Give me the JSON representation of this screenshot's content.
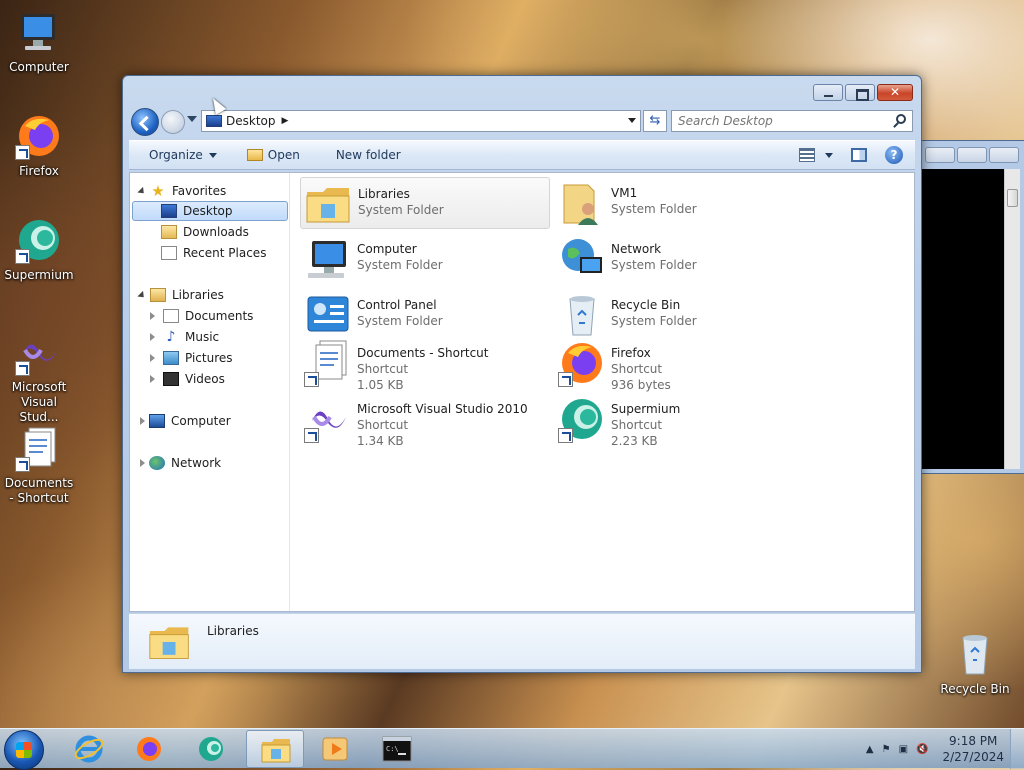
{
  "desktop": {
    "icons": [
      {
        "label": "Computer",
        "icon": "computer-icon"
      },
      {
        "label": "Firefox",
        "icon": "firefox-icon"
      },
      {
        "label": "Supermium",
        "icon": "supermium-icon"
      },
      {
        "label": "Microsoft Visual Stud...",
        "icon": "visual-studio-icon"
      },
      {
        "label": "Documents - Shortcut",
        "icon": "documents-icon"
      },
      {
        "label": "Recycle Bin",
        "icon": "recycle-bin-icon"
      }
    ]
  },
  "explorer": {
    "address": {
      "location": "Desktop"
    },
    "search": {
      "placeholder": "Search Desktop"
    },
    "toolbar": {
      "organize_label": "Organize",
      "open_label": "Open",
      "new_folder_label": "New folder"
    },
    "nav": {
      "favorites": {
        "label": "Favorites",
        "items": [
          "Desktop",
          "Downloads",
          "Recent Places"
        ],
        "selected": "Desktop"
      },
      "libraries": {
        "label": "Libraries",
        "items": [
          "Documents",
          "Music",
          "Pictures",
          "Videos"
        ]
      },
      "computer_label": "Computer",
      "network_label": "Network"
    },
    "items": [
      {
        "name": "Libraries",
        "type": "System Folder",
        "size": "",
        "icon": "libraries-folder-icon"
      },
      {
        "name": "VM1",
        "type": "System Folder",
        "size": "",
        "icon": "user-folder-icon"
      },
      {
        "name": "Computer",
        "type": "System Folder",
        "size": "",
        "icon": "computer-icon"
      },
      {
        "name": "Network",
        "type": "System Folder",
        "size": "",
        "icon": "network-icon"
      },
      {
        "name": "Control Panel",
        "type": "System Folder",
        "size": "",
        "icon": "control-panel-icon"
      },
      {
        "name": "Recycle Bin",
        "type": "System Folder",
        "size": "",
        "icon": "recycle-bin-icon"
      },
      {
        "name": "Documents - Shortcut",
        "type": "Shortcut",
        "size": "1.05 KB",
        "icon": "documents-icon"
      },
      {
        "name": "Firefox",
        "type": "Shortcut",
        "size": "936 bytes",
        "icon": "firefox-icon"
      },
      {
        "name": "Microsoft Visual Studio 2010",
        "type": "Shortcut",
        "size": "1.34 KB",
        "icon": "visual-studio-icon"
      },
      {
        "name": "Supermium",
        "type": "Shortcut",
        "size": "2.23 KB",
        "icon": "supermium-icon"
      }
    ],
    "details": {
      "name": "Libraries"
    }
  },
  "taskbar": {
    "apps": [
      "internet-explorer-icon",
      "firefox-icon",
      "supermium-icon",
      "explorer-icon",
      "media-player-icon",
      "cmd-icon"
    ],
    "active_app": "explorer-icon",
    "clock": {
      "time": "9:18 PM",
      "date": "2/27/2024"
    }
  }
}
